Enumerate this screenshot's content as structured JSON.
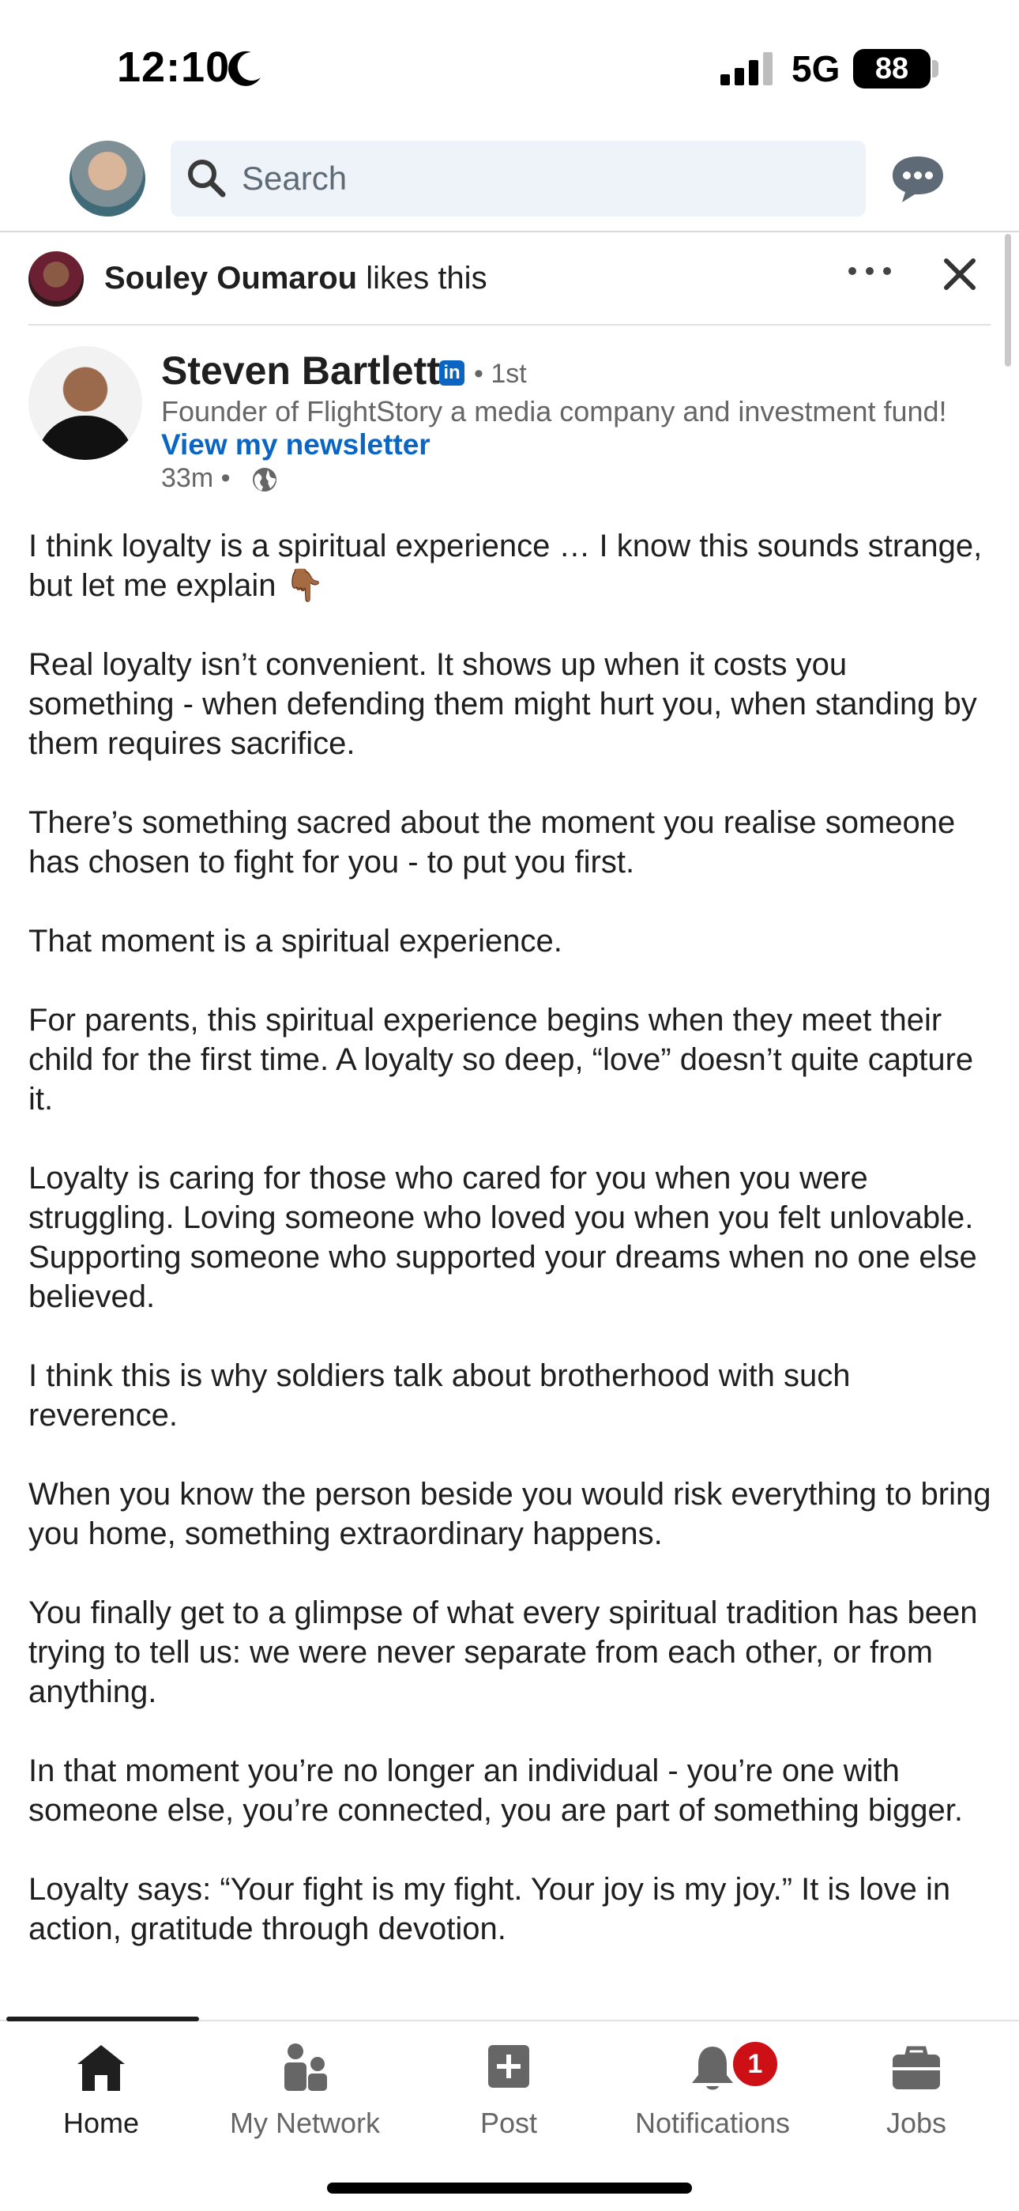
{
  "status_bar": {
    "time": "12:10",
    "network": "5G",
    "battery": "88"
  },
  "header": {
    "search_placeholder": "Search"
  },
  "social_context": {
    "name": "Souley Oumarou",
    "action": "likes this"
  },
  "author": {
    "name": "Steven Bartlett",
    "badge": "in",
    "degree": "• 1st",
    "headline": "Founder of FlightStory a media company and investment fund!",
    "cta": "View my newsletter",
    "time": "33m •"
  },
  "post": {
    "paragraphs": [
      "I think loyalty is a spiritual experience … I know this sounds strange, but let me explain 👇🏾",
      "Real loyalty isn’t convenient. It shows up when it costs you something - when defending them might hurt you, when standing by them requires sacrifice.",
      "There’s something sacred about the moment you realise someone has chosen to fight for you - to put you first.",
      "That moment is a spiritual experience.",
      "For parents, this spiritual experience begins when they meet their child for the first time. A loyalty so deep, “love” doesn’t quite capture it.",
      "Loyalty is caring for those who cared for you when you were struggling. Loving someone who loved you when you felt unlovable. Supporting someone who supported your dreams when no one else believed.",
      "I think this is why soldiers talk about brotherhood with such reverence.",
      "When you know the person beside you would risk everything to bring you home, something extraordinary happens.",
      "You finally get to a glimpse of what every spiritual tradition has been trying to tell us: we were never separate from each other, or from anything.",
      "In that moment you’re no longer an individual - you’re one with someone else, you’re connected, you are part of something bigger.",
      "Loyalty says: “Your fight is my fight. Your joy is my joy.” It is love in action, gratitude through devotion."
    ]
  },
  "bottom_nav": {
    "items": [
      {
        "label": "Home",
        "icon": "home-icon",
        "active": true
      },
      {
        "label": "My Network",
        "icon": "network-icon"
      },
      {
        "label": "Post",
        "icon": "post-icon"
      },
      {
        "label": "Notifications",
        "icon": "bell-icon",
        "badge": "1"
      },
      {
        "label": "Jobs",
        "icon": "briefcase-icon"
      }
    ]
  },
  "colors": {
    "brand_blue": "#0a66c2",
    "badge_red": "#cc1016",
    "search_bg": "#edf3f8"
  }
}
